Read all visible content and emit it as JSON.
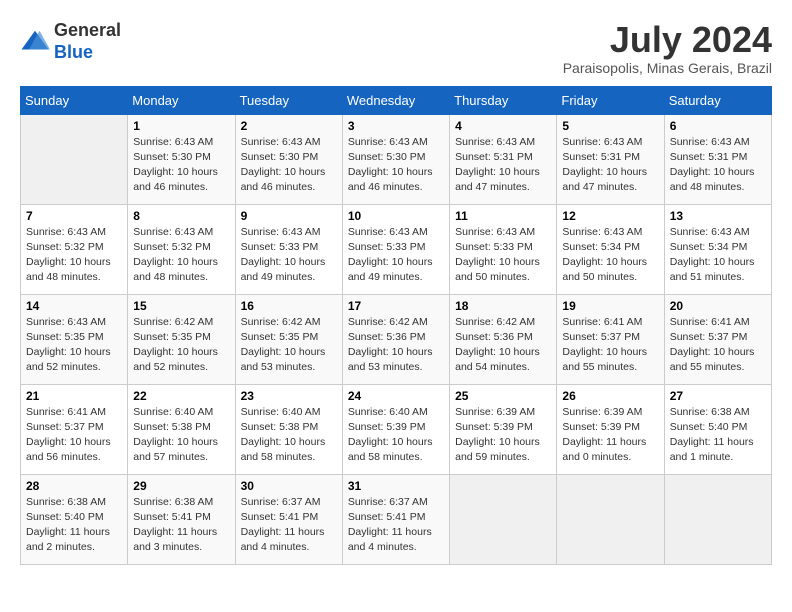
{
  "header": {
    "logo_line1": "General",
    "logo_line2": "Blue",
    "month": "July 2024",
    "location": "Paraisopolis, Minas Gerais, Brazil"
  },
  "days_of_week": [
    "Sunday",
    "Monday",
    "Tuesday",
    "Wednesday",
    "Thursday",
    "Friday",
    "Saturday"
  ],
  "weeks": [
    [
      {
        "day": "",
        "info": ""
      },
      {
        "day": "1",
        "info": "Sunrise: 6:43 AM\nSunset: 5:30 PM\nDaylight: 10 hours\nand 46 minutes."
      },
      {
        "day": "2",
        "info": "Sunrise: 6:43 AM\nSunset: 5:30 PM\nDaylight: 10 hours\nand 46 minutes."
      },
      {
        "day": "3",
        "info": "Sunrise: 6:43 AM\nSunset: 5:30 PM\nDaylight: 10 hours\nand 46 minutes."
      },
      {
        "day": "4",
        "info": "Sunrise: 6:43 AM\nSunset: 5:31 PM\nDaylight: 10 hours\nand 47 minutes."
      },
      {
        "day": "5",
        "info": "Sunrise: 6:43 AM\nSunset: 5:31 PM\nDaylight: 10 hours\nand 47 minutes."
      },
      {
        "day": "6",
        "info": "Sunrise: 6:43 AM\nSunset: 5:31 PM\nDaylight: 10 hours\nand 48 minutes."
      }
    ],
    [
      {
        "day": "7",
        "info": "Sunrise: 6:43 AM\nSunset: 5:32 PM\nDaylight: 10 hours\nand 48 minutes."
      },
      {
        "day": "8",
        "info": "Sunrise: 6:43 AM\nSunset: 5:32 PM\nDaylight: 10 hours\nand 48 minutes."
      },
      {
        "day": "9",
        "info": "Sunrise: 6:43 AM\nSunset: 5:33 PM\nDaylight: 10 hours\nand 49 minutes."
      },
      {
        "day": "10",
        "info": "Sunrise: 6:43 AM\nSunset: 5:33 PM\nDaylight: 10 hours\nand 49 minutes."
      },
      {
        "day": "11",
        "info": "Sunrise: 6:43 AM\nSunset: 5:33 PM\nDaylight: 10 hours\nand 50 minutes."
      },
      {
        "day": "12",
        "info": "Sunrise: 6:43 AM\nSunset: 5:34 PM\nDaylight: 10 hours\nand 50 minutes."
      },
      {
        "day": "13",
        "info": "Sunrise: 6:43 AM\nSunset: 5:34 PM\nDaylight: 10 hours\nand 51 minutes."
      }
    ],
    [
      {
        "day": "14",
        "info": "Sunrise: 6:43 AM\nSunset: 5:35 PM\nDaylight: 10 hours\nand 52 minutes."
      },
      {
        "day": "15",
        "info": "Sunrise: 6:42 AM\nSunset: 5:35 PM\nDaylight: 10 hours\nand 52 minutes."
      },
      {
        "day": "16",
        "info": "Sunrise: 6:42 AM\nSunset: 5:35 PM\nDaylight: 10 hours\nand 53 minutes."
      },
      {
        "day": "17",
        "info": "Sunrise: 6:42 AM\nSunset: 5:36 PM\nDaylight: 10 hours\nand 53 minutes."
      },
      {
        "day": "18",
        "info": "Sunrise: 6:42 AM\nSunset: 5:36 PM\nDaylight: 10 hours\nand 54 minutes."
      },
      {
        "day": "19",
        "info": "Sunrise: 6:41 AM\nSunset: 5:37 PM\nDaylight: 10 hours\nand 55 minutes."
      },
      {
        "day": "20",
        "info": "Sunrise: 6:41 AM\nSunset: 5:37 PM\nDaylight: 10 hours\nand 55 minutes."
      }
    ],
    [
      {
        "day": "21",
        "info": "Sunrise: 6:41 AM\nSunset: 5:37 PM\nDaylight: 10 hours\nand 56 minutes."
      },
      {
        "day": "22",
        "info": "Sunrise: 6:40 AM\nSunset: 5:38 PM\nDaylight: 10 hours\nand 57 minutes."
      },
      {
        "day": "23",
        "info": "Sunrise: 6:40 AM\nSunset: 5:38 PM\nDaylight: 10 hours\nand 58 minutes."
      },
      {
        "day": "24",
        "info": "Sunrise: 6:40 AM\nSunset: 5:39 PM\nDaylight: 10 hours\nand 58 minutes."
      },
      {
        "day": "25",
        "info": "Sunrise: 6:39 AM\nSunset: 5:39 PM\nDaylight: 10 hours\nand 59 minutes."
      },
      {
        "day": "26",
        "info": "Sunrise: 6:39 AM\nSunset: 5:39 PM\nDaylight: 11 hours\nand 0 minutes."
      },
      {
        "day": "27",
        "info": "Sunrise: 6:38 AM\nSunset: 5:40 PM\nDaylight: 11 hours\nand 1 minute."
      }
    ],
    [
      {
        "day": "28",
        "info": "Sunrise: 6:38 AM\nSunset: 5:40 PM\nDaylight: 11 hours\nand 2 minutes."
      },
      {
        "day": "29",
        "info": "Sunrise: 6:38 AM\nSunset: 5:41 PM\nDaylight: 11 hours\nand 3 minutes."
      },
      {
        "day": "30",
        "info": "Sunrise: 6:37 AM\nSunset: 5:41 PM\nDaylight: 11 hours\nand 4 minutes."
      },
      {
        "day": "31",
        "info": "Sunrise: 6:37 AM\nSunset: 5:41 PM\nDaylight: 11 hours\nand 4 minutes."
      },
      {
        "day": "",
        "info": ""
      },
      {
        "day": "",
        "info": ""
      },
      {
        "day": "",
        "info": ""
      }
    ]
  ]
}
